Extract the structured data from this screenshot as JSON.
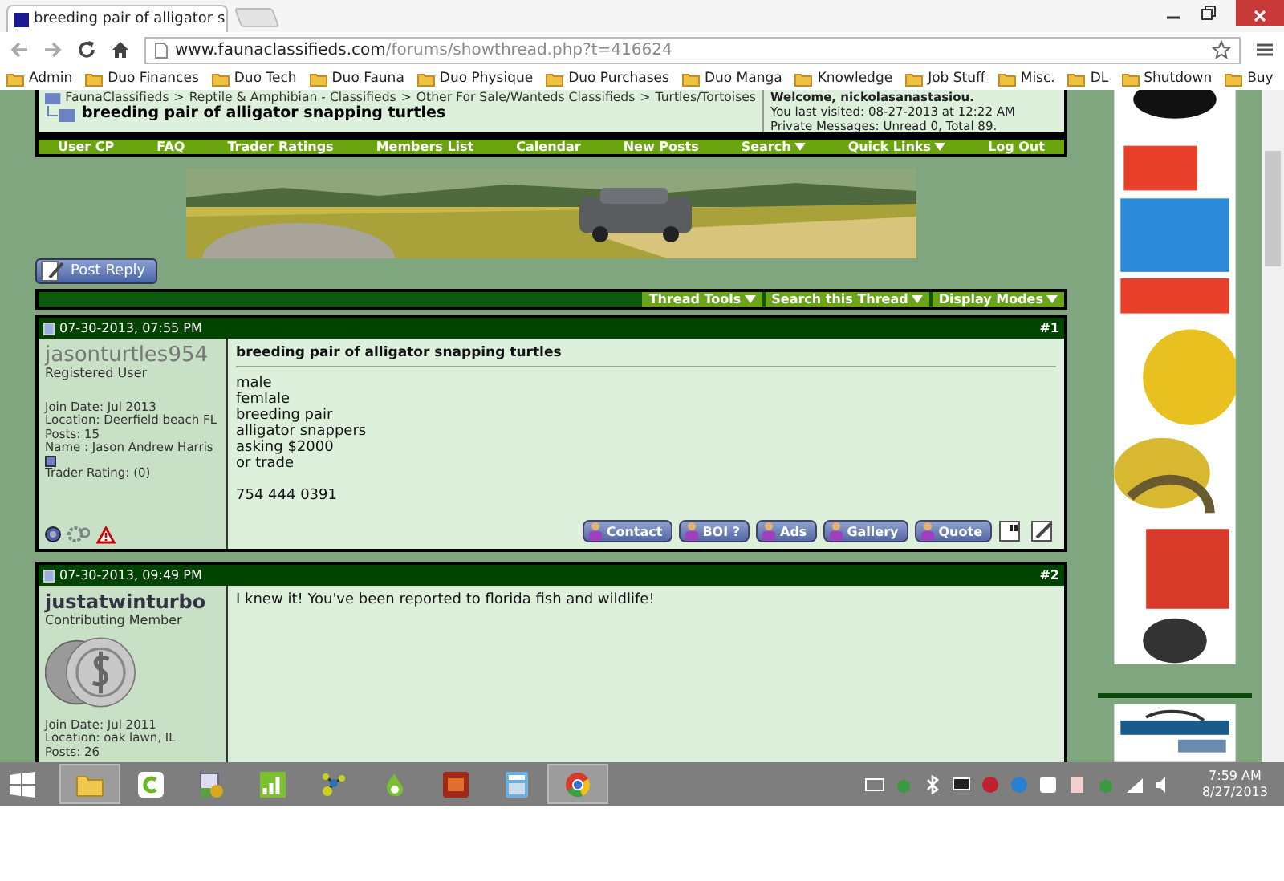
{
  "browser": {
    "tab_title": "breeding pair of alligator s",
    "url_host": "www.faunaclassifieds.com",
    "url_path": "/forums/showthread.php?t=416624",
    "bookmarks": [
      "Admin",
      "Duo Finances",
      "Duo Tech",
      "Duo Fauna",
      "Duo Physique",
      "Duo Purchases",
      "Duo Manga",
      "Knowledge",
      "Job Stuff",
      "Misc.",
      "DL",
      "Shutdown",
      "Buy"
    ]
  },
  "forum": {
    "crumb_separator": ">",
    "breadcrumb": [
      "FaunaClassifieds",
      "Reptile & Amphibian - Classifieds",
      "Other For Sale/Wanteds Classifieds",
      "Turtles/Tortoises"
    ],
    "thread_title": "breeding pair of alligator snapping turtles",
    "welcome": "Welcome, nickolasanastasiou.",
    "last_visited": "You last visited: 08-27-2013 at 12:22 AM",
    "private_messages": "Private Messages: Unread 0, Total 89.",
    "nav": [
      {
        "label": "User CP",
        "dropdown": false
      },
      {
        "label": "FAQ",
        "dropdown": false
      },
      {
        "label": "Trader Ratings",
        "dropdown": false
      },
      {
        "label": "Members List",
        "dropdown": false
      },
      {
        "label": "Calendar",
        "dropdown": false
      },
      {
        "label": "New Posts",
        "dropdown": false
      },
      {
        "label": "Search",
        "dropdown": true
      },
      {
        "label": "Quick Links",
        "dropdown": true
      },
      {
        "label": "Log Out",
        "dropdown": false
      }
    ],
    "post_reply": "Post Reply",
    "thread_tools": [
      "Thread Tools",
      "Search this Thread",
      "Display Modes"
    ],
    "posts": [
      {
        "date": "07-30-2013, 07:55 PM",
        "number": "#1",
        "username": "jasonturtles954",
        "username_bold": false,
        "user_title": "Registered User",
        "avatar": false,
        "details": [
          "Join Date: Jul 2013",
          "Location: Deerfield beach FL",
          "Posts: 15",
          "Name : Jason Andrew Harris"
        ],
        "trader_rating": "Trader Rating: (0)",
        "subject": "breeding pair of alligator snapping turtles",
        "paragraphs": [
          [
            "male",
            "femlale",
            "breeding pair",
            "alligator snappers",
            "asking $2000",
            "or trade"
          ],
          [
            "754 444 0391"
          ]
        ],
        "buttons": [
          "Contact",
          "BOI ?",
          "Ads",
          "Gallery",
          "Quote"
        ]
      },
      {
        "date": "07-30-2013, 09:49 PM",
        "number": "#2",
        "username": "justatwinturbo",
        "username_bold": true,
        "user_title": "Contributing Member",
        "avatar": true,
        "details": [
          "Join Date: Jul 2011",
          "Location: oak lawn, IL",
          "Posts: 26"
        ],
        "paragraphs": [
          [
            "I knew it! You've been reported to florida fish and wildlife!"
          ]
        ]
      }
    ]
  },
  "taskbar": {
    "apps": [
      {
        "kind": "folder",
        "running": true
      },
      {
        "kind": "c",
        "running": false
      },
      {
        "kind": "money",
        "running": false
      },
      {
        "kind": "chart",
        "running": false
      },
      {
        "kind": "nodes",
        "running": false
      },
      {
        "kind": "flame",
        "running": false
      },
      {
        "kind": "game",
        "running": false
      },
      {
        "kind": "calculator",
        "running": false
      },
      {
        "kind": "browser",
        "running": true
      }
    ],
    "time": "7:59 AM",
    "date": "8/27/2013"
  }
}
